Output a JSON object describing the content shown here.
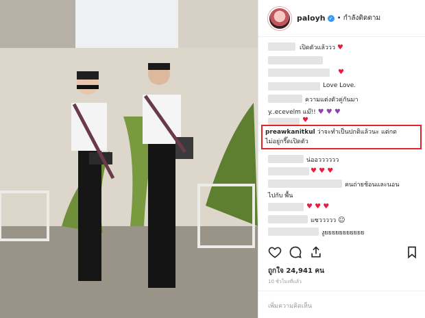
{
  "post": {
    "username": "paloyh",
    "follow_label": "• กำลังติดตาม",
    "likes_label": "ถูกใจ 24,941 คน",
    "time_label": "10 ชั่วโมงที่แล้ว",
    "add_comment_placeholder": "เพิ่มความคิดเห็น"
  },
  "comments": [
    {
      "text": "เปิดตัวแล้ววว"
    },
    {
      "text": "Love Love."
    },
    {
      "text": "ความแต่งตัวคู่กันมา"
    },
    {
      "text": "y..ecevelm แม๊!!"
    },
    {
      "text": "น่ออวววววว"
    },
    {
      "text": "คนถ่ายช้อนและนอน"
    },
    {
      "text": "ไปกับ พื้น"
    },
    {
      "text": "แซววววว"
    },
    {
      "text": "งูยยยยยยยยยยย"
    }
  ],
  "highlighted_comment": {
    "username": "preawkanitkul",
    "text_line1": "ว่าจะทำเป็นปกติแล้วนะ แต่กด",
    "text_line2": "ไม่อยู่กรี๊ดเปิดตัว"
  },
  "icons": [
    "verified-badge-icon",
    "heart-icon",
    "comment-icon",
    "share-icon",
    "bookmark-icon"
  ],
  "colors": {
    "verified": "#3897f0",
    "highlight_border": "#e02424",
    "heart": "#ed1b3a"
  }
}
